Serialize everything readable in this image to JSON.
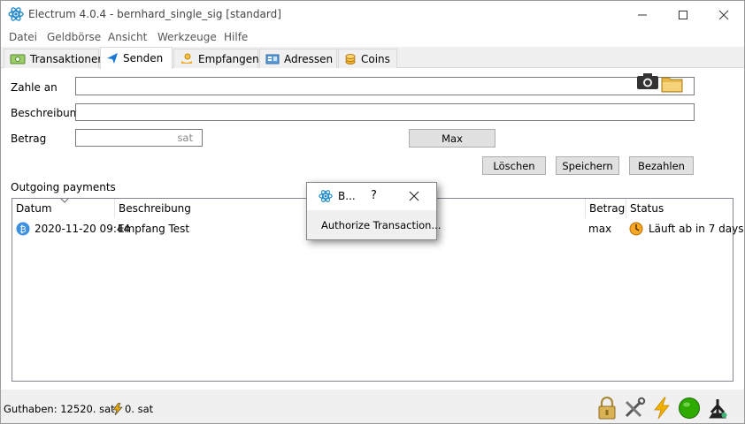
{
  "window": {
    "title": "Electrum 4.0.4  -  bernhard_single_sig  [standard]"
  },
  "menu": {
    "items": [
      "Datei",
      "Geldbörse",
      "Ansicht",
      "Werkzeuge",
      "Hilfe"
    ]
  },
  "tabs": [
    {
      "label": "Transaktionen",
      "icon": "wallet-icon"
    },
    {
      "label": "Senden",
      "icon": "send-icon",
      "active": true
    },
    {
      "label": "Empfangen",
      "icon": "receive-icon"
    },
    {
      "label": "Adressen",
      "icon": "addresses-icon"
    },
    {
      "label": "Coins",
      "icon": "coins-icon"
    }
  ],
  "send_form": {
    "pay_to_label": "Zahle an",
    "pay_to_value": "",
    "description_label": "Beschreibung",
    "description_value": "",
    "amount_label": "Betrag",
    "amount_value": "",
    "amount_unit": "sat",
    "max_button": "Max",
    "clear_button": "Löschen",
    "save_button": "Speichern",
    "pay_button": "Bezahlen"
  },
  "outgoing": {
    "section_label": "Outgoing payments",
    "columns": [
      "Datum",
      "Beschreibung",
      "Betrag",
      "Status"
    ],
    "rows": [
      {
        "date": "2020-11-20 09:44",
        "description": "Empfang Test",
        "amount": "max",
        "status": "Läuft ab in 7 days"
      }
    ]
  },
  "dialog": {
    "title": "B...",
    "help": "?",
    "message": "Authorize Transaction..."
  },
  "statusbar": {
    "balance": "Guthaben: 12520. sat",
    "lightning_balance": "0. sat",
    "icons": [
      "lock-icon",
      "tools-icon",
      "lightning-icon",
      "network-status-icon",
      "seed-icon"
    ]
  },
  "colors": {
    "accent": "#1976d2",
    "bitcoin": "#3d8fe0",
    "network_ok": "#2eaa00",
    "lightning": "#f2b100"
  }
}
